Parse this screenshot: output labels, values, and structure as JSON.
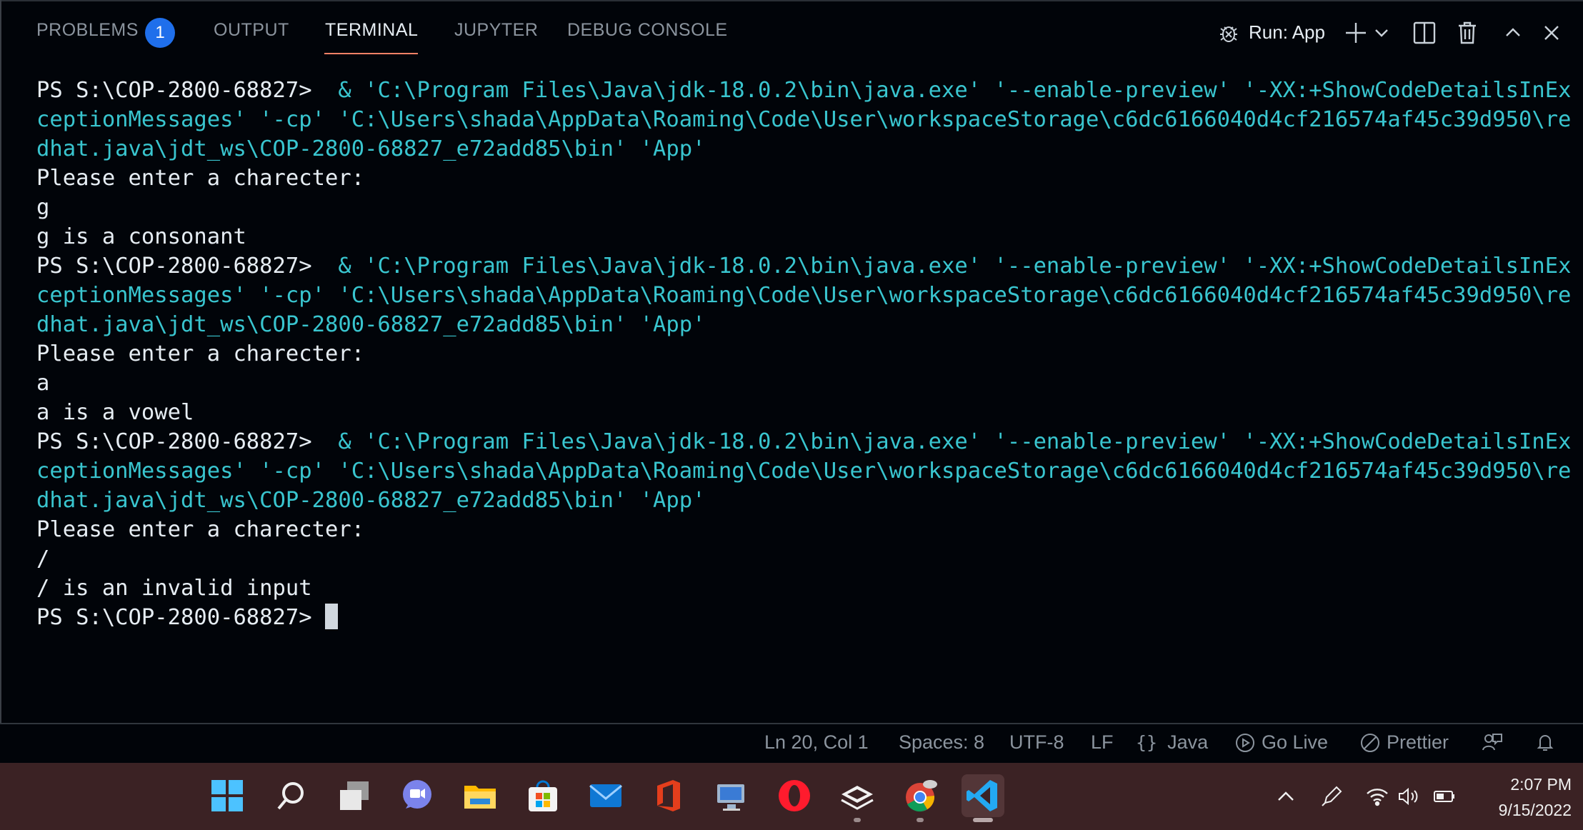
{
  "panel": {
    "tabs": [
      {
        "label": "PROBLEMS",
        "badge": "1"
      },
      {
        "label": "OUTPUT"
      },
      {
        "label": "TERMINAL",
        "active": true
      },
      {
        "label": "JUPYTER"
      },
      {
        "label": "DEBUG CONSOLE"
      }
    ],
    "run_label": "Run: App",
    "toolbar_icons": [
      "debug-icon",
      "add-terminal-icon",
      "chevron-down-icon",
      "split-terminal-icon",
      "trash-icon",
      "maximize-panel-icon",
      "close-panel-icon"
    ]
  },
  "terminal": {
    "prompt": "PS S:\\COP-2800-68827> ",
    "command_line_1": "& 'C:\\Program Files\\Java\\jdk-18.0.2\\bin\\java.exe' '--enable-preview' '-XX:+ShowCodeDetailsInEx",
    "command_line_2": "ceptionMessages' '-cp' 'C:\\Users\\shada\\AppData\\Roaming\\Code\\User\\workspaceStorage\\c6dc6166040d4cf216574af45c39d950\\re",
    "command_line_3": "dhat.java\\jdt_ws\\COP-2800-68827_e72add85\\bin' 'App'",
    "runs": [
      {
        "prompt_text": "Please enter a charecter:",
        "input": "g",
        "result": "g is a consonant"
      },
      {
        "prompt_text": "Please enter a charecter:",
        "input": "a",
        "result": "a is a vowel"
      },
      {
        "prompt_text": "Please enter a charecter:",
        "input": "/",
        "result": "/ is an invalid input"
      }
    ],
    "final_prompt": "PS S:\\COP-2800-68827> "
  },
  "statusbar": {
    "position": "Ln 20, Col 1",
    "spaces": "Spaces: 8",
    "encoding": "UTF-8",
    "eol": "LF",
    "language": "Java",
    "language_icon": "braces-icon",
    "go_live": "Go Live",
    "prettier": "Prettier"
  },
  "taskbar": {
    "apps": [
      "windows-start-icon",
      "search-icon",
      "task-view-icon",
      "teams-chat-icon",
      "file-explorer-icon",
      "microsoft-store-icon",
      "mail-icon",
      "office-icon",
      "remote-desktop-icon",
      "opera-icon",
      "stack-app-icon",
      "chrome-icon",
      "vscode-icon"
    ],
    "time": "2:07 PM",
    "date": "9/15/2022"
  },
  "colors": {
    "background": "#010409",
    "cyan_text": "#39c5cf",
    "active_tab_underline": "#f78166",
    "badge": "#1f6feb",
    "taskbar": "#3b2224"
  }
}
